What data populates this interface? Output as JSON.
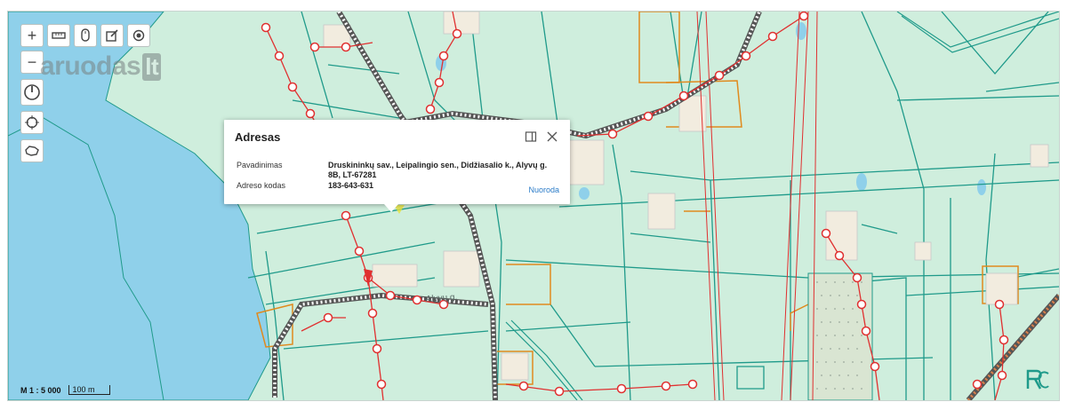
{
  "watermark": {
    "text": "aruodas",
    "suffix": "lt"
  },
  "toolbar": {
    "zoom_in": "+",
    "zoom_out": "−",
    "icons": [
      "ruler-icon",
      "mouse-icon",
      "edit-icon",
      "target-icon"
    ]
  },
  "popup": {
    "title": "Adresas",
    "rows": [
      {
        "label": "Pavadinimas",
        "value_line1": "Druskininkų sav., Leipalingio sen., Didžiasalio k., Alyvų g.",
        "value_line2": "8B, LT-67281"
      },
      {
        "label": "Adreso kodas",
        "value_line1": "183-643-631"
      }
    ],
    "link": "Nuoroda"
  },
  "scale": {
    "ratio": "M 1 : 5 000",
    "bar": "100 m"
  },
  "map_labels": {
    "street": "Alyvų g."
  },
  "colors": {
    "land": "#cfeedd",
    "water": "#8fd0ea",
    "parcel": "#1f9a8a",
    "railway": "#555555",
    "powerline": "#e03030",
    "orange_parcel": "#e08a1e"
  }
}
